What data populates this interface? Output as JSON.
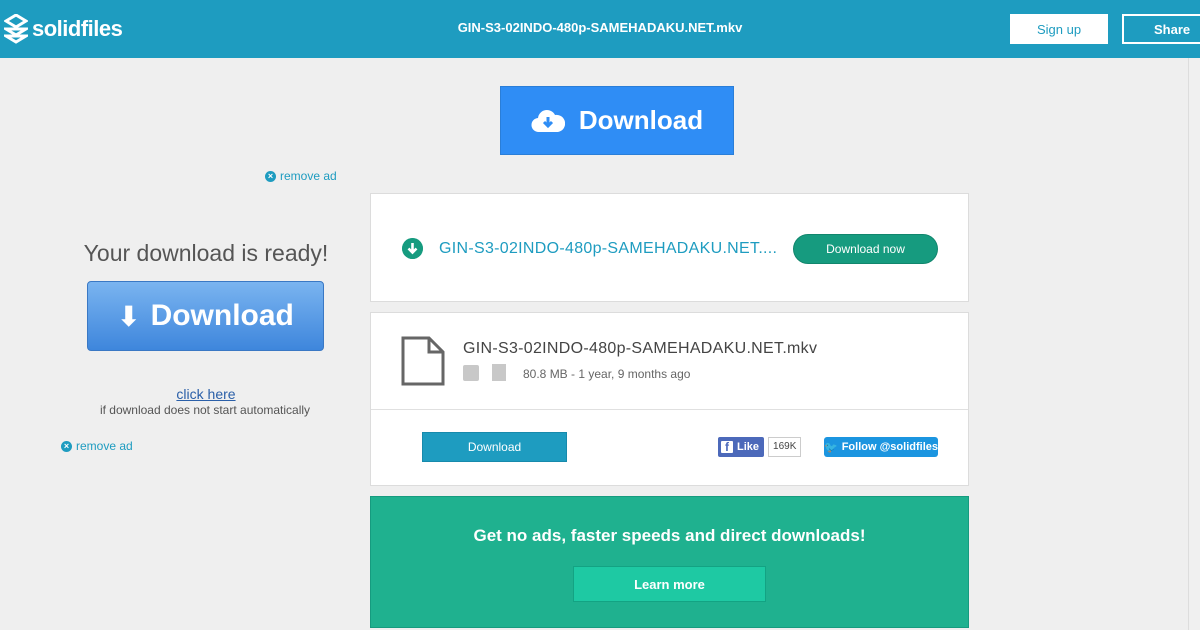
{
  "header": {
    "brand": "solidfiles",
    "title": "GIN-S3-02INDO-480p-SAMEHADAKU.NET.mkv",
    "signup_label": "Sign up",
    "share_label": "Share"
  },
  "top_download": {
    "label": "Download"
  },
  "remove_ad_label": "remove ad",
  "left_ad": {
    "ready_text": "Your download is ready!",
    "button_label": "Download",
    "click_here": "click here",
    "note": "if download does not start automatically"
  },
  "download_card": {
    "filename_truncated": "GIN-S3-02INDO-480p-SAMEHADAKU.NET....",
    "download_now_label": "Download now"
  },
  "file_card": {
    "filename": "GIN-S3-02INDO-480p-SAMEHADAKU.NET.mkv",
    "meta": "80.8 MB - 1 year, 9 months ago",
    "download_label": "Download",
    "fb_like_label": "Like",
    "fb_like_count": "169K",
    "twitter_label": "Follow @solidfiles"
  },
  "promo": {
    "text": "Get no ads, faster speeds and direct downloads!",
    "button_label": "Learn more"
  },
  "colors": {
    "header": "#1e9cc0",
    "top_download": "#2f8df5",
    "green": "#169b7f",
    "promo": "#1fb18f"
  }
}
